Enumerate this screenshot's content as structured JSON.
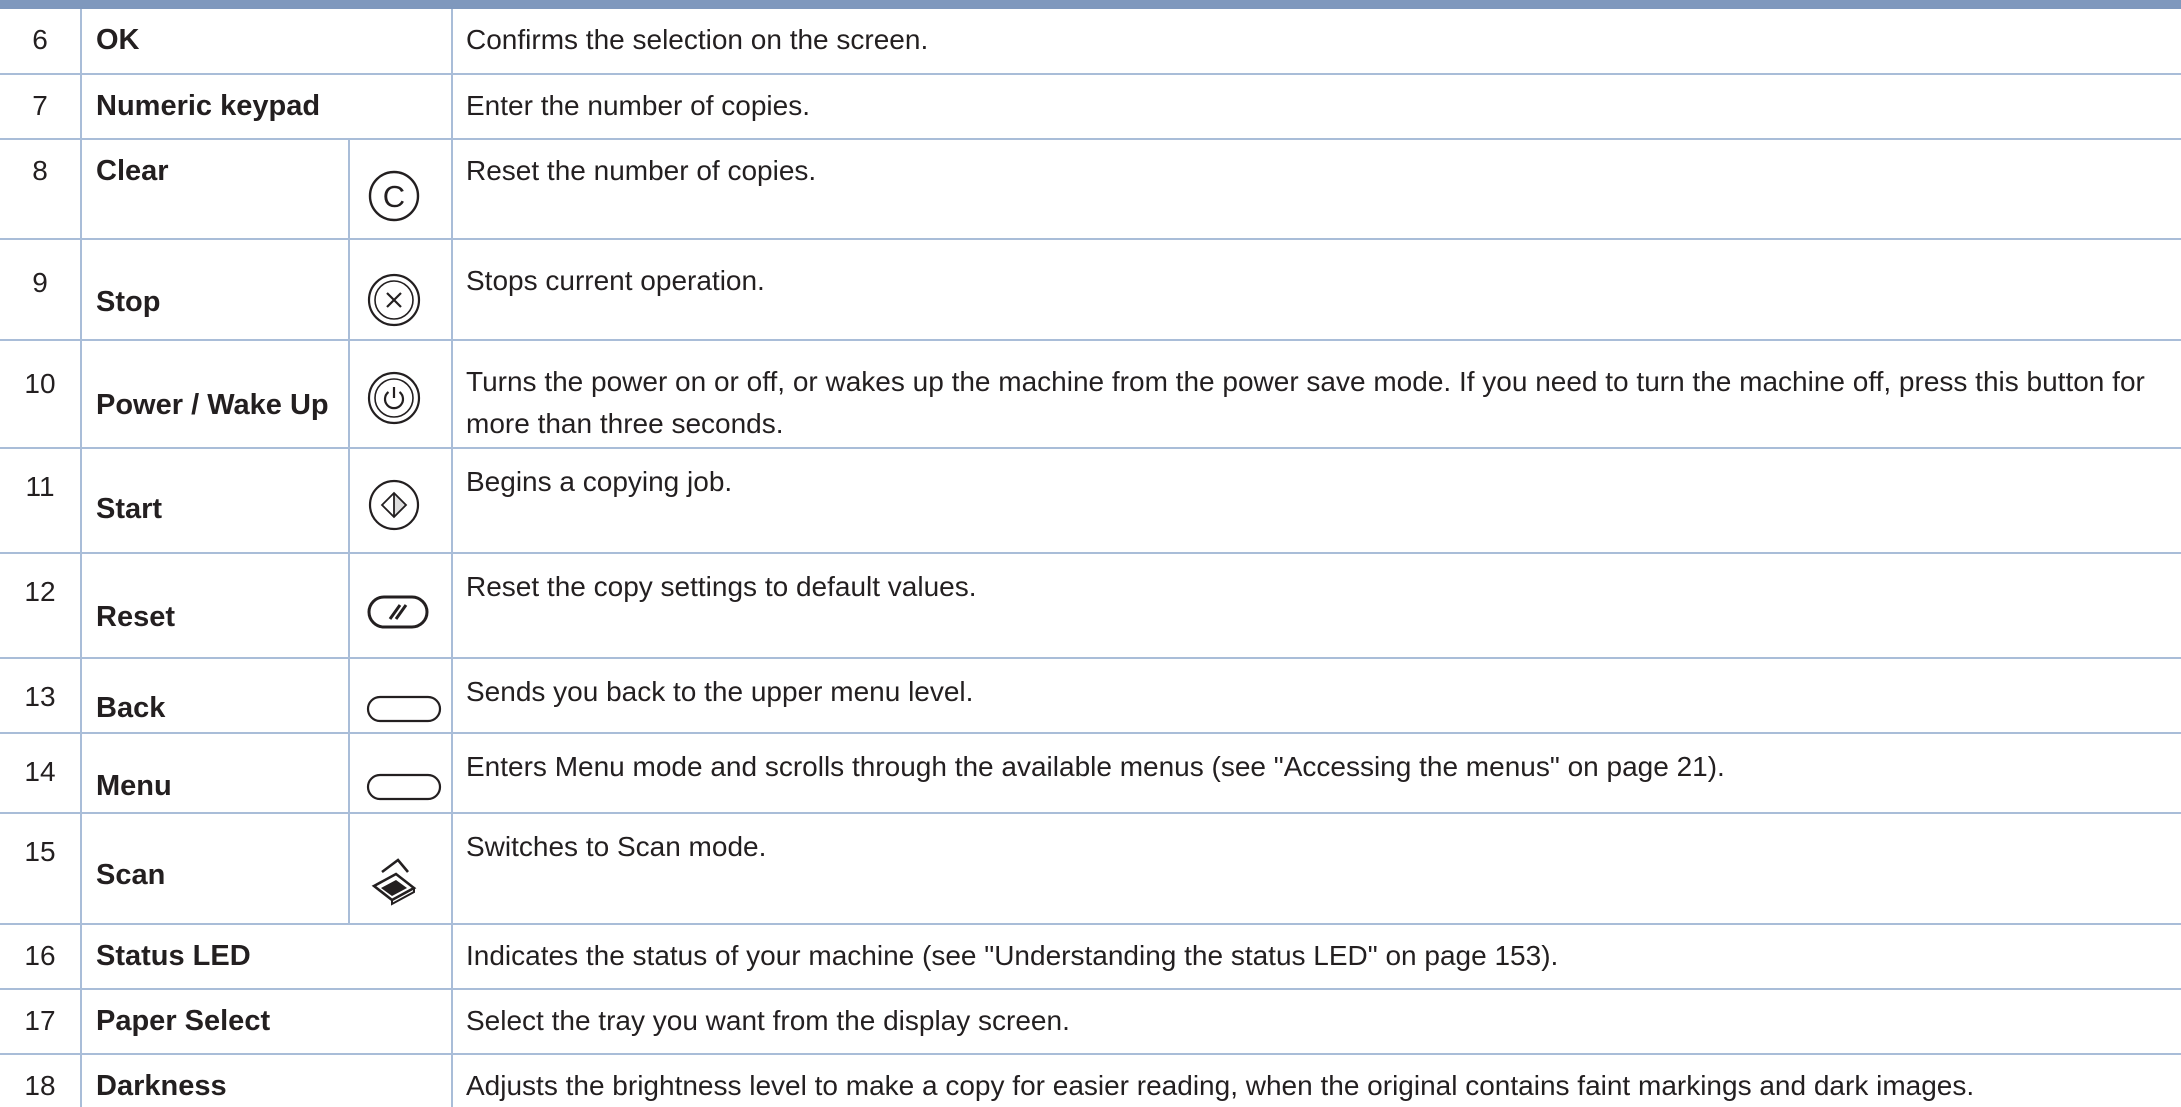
{
  "table": {
    "rows": [
      {
        "num": "6",
        "name": "OK",
        "icon": "",
        "desc": "Confirms the selection on the screen."
      },
      {
        "num": "7",
        "name": "Numeric keypad",
        "icon": "",
        "desc": "Enter the number of copies."
      },
      {
        "num": "8",
        "name": "Clear",
        "icon": "clear-icon",
        "desc": "Reset the number of copies."
      },
      {
        "num": "9",
        "name": "Stop",
        "icon": "stop-icon",
        "desc": "Stops current operation."
      },
      {
        "num": "10",
        "name": "Power / Wake Up",
        "icon": "power-icon",
        "desc": "Turns the power on or off, or wakes up the machine from the power save mode. If you need to turn the machine off, press this button for more than three seconds."
      },
      {
        "num": "11",
        "name": "Start",
        "icon": "start-icon",
        "desc": "Begins a copying job."
      },
      {
        "num": "12",
        "name": "Reset",
        "icon": "reset-icon",
        "desc": "Reset the copy settings to default values."
      },
      {
        "num": "13",
        "name": "Back",
        "icon": "back-button-icon",
        "desc": "Sends you back to the upper menu level."
      },
      {
        "num": "14",
        "name": "Menu",
        "icon": "menu-button-icon",
        "desc": "Enters Menu mode and scrolls through the available menus (see \"Accessing the menus\" on page 21)."
      },
      {
        "num": "15",
        "name": "Scan",
        "icon": "scan-icon",
        "desc": "Switches to Scan mode."
      },
      {
        "num": "16",
        "name": "Status LED",
        "icon": "",
        "desc": "Indicates the status of your machine (see \"Understanding the status LED\" on page 153)."
      },
      {
        "num": "17",
        "name": "Paper Select",
        "icon": "",
        "desc": "Select the tray you want from the display screen."
      },
      {
        "num": "18",
        "name": "Darkness",
        "icon": "",
        "desc": "Adjusts the brightness level to make a copy for easier reading, when the original contains faint markings and dark images."
      }
    ]
  }
}
